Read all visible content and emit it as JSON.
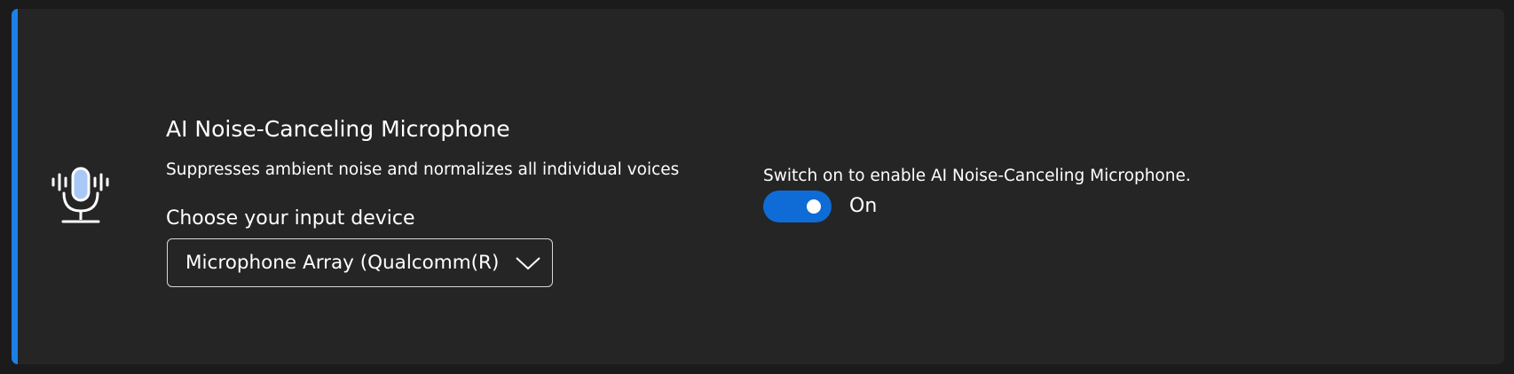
{
  "colors": {
    "accent": "#1e7fe8",
    "toggle_on": "#0f6cd6",
    "icon_fill": "#a9c8f5"
  },
  "feature": {
    "icon": "microphone-noise-cancel-icon",
    "title": "AI Noise-Canceling Microphone",
    "description": "Suppresses ambient noise and normalizes all individual voices"
  },
  "input_device": {
    "label": "Choose your input device",
    "selected": "Microphone Array (Qualcomm(R)",
    "dropdown_icon": "chevron-down-icon"
  },
  "switch": {
    "hint": "Switch on to enable AI Noise-Canceling Microphone.",
    "state_label": "On",
    "is_on": true
  }
}
